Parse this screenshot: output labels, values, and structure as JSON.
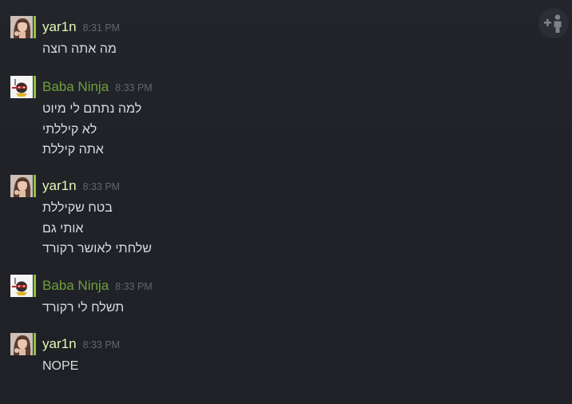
{
  "messages": [
    {
      "author": "yar1n",
      "time": "8:31 PM",
      "status": "ingame",
      "avatar_icon": "girl-portrait",
      "lines": [
        "מה אתה רוצה"
      ]
    },
    {
      "author": "Baba Ninja",
      "time": "8:33 PM",
      "status": "online",
      "avatar_icon": "ninja-character",
      "lines": [
        "למה נתתם לי מיוט",
        "לא קיללתי",
        "אתה קיללת"
      ]
    },
    {
      "author": "yar1n",
      "time": "8:33 PM",
      "status": "ingame",
      "avatar_icon": "girl-portrait",
      "lines": [
        "בטח שקיללת",
        "אותי גם",
        "שלחתי לאושר רקורד"
      ]
    },
    {
      "author": "Baba Ninja",
      "time": "8:33 PM",
      "status": "online",
      "avatar_icon": "ninja-character",
      "lines": [
        "תשלח לי רקורד"
      ]
    },
    {
      "author": "yar1n",
      "time": "8:33 PM",
      "status": "ingame",
      "avatar_icon": "girl-portrait",
      "lines": [
        "NOPE"
      ]
    }
  ],
  "toolbar": {
    "add_user_icon": "add-user-icon"
  },
  "colors": {
    "background": "#1f2126",
    "ingame_name": "#e3f8b8",
    "online_name": "#6f9f3c",
    "status_bar": "#8bc53f",
    "timestamp": "#62656b",
    "message_text": "#d8dadd"
  }
}
